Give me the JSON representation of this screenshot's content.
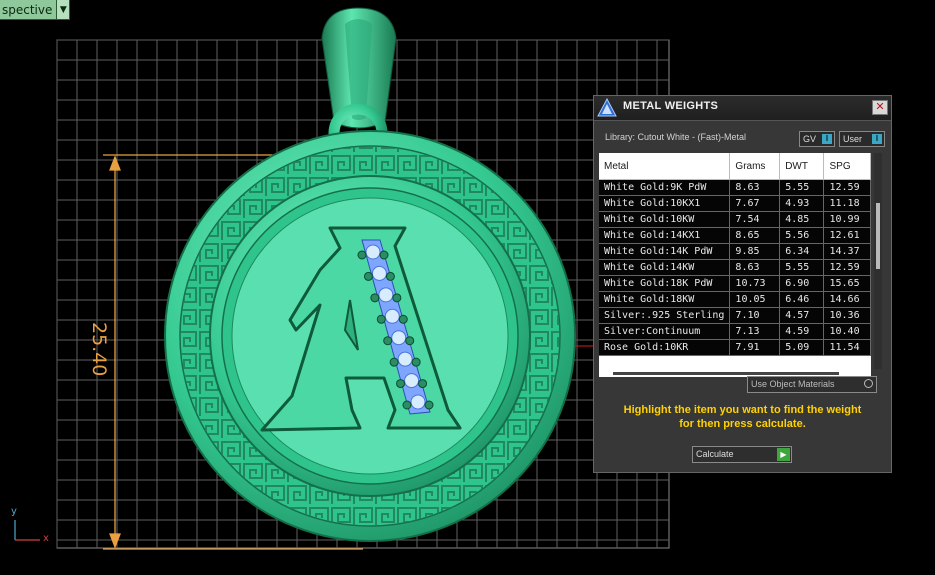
{
  "viewport": {
    "view_name": "spective",
    "dimension_label": "25.40",
    "axis_y": "y",
    "axis_x": "x"
  },
  "panel": {
    "title": "METAL WEIGHTS",
    "close_glyph": "✕",
    "library_label": "Library: Cutout White - (Fast)-Metal",
    "gv_label": "GV",
    "user_label": "User",
    "columns": [
      "Metal",
      "Grams",
      "DWT",
      "SPG"
    ],
    "rows": [
      [
        "White Gold:9K PdW",
        "8.63",
        "5.55",
        "12.59"
      ],
      [
        "White Gold:10KX1",
        "7.67",
        "4.93",
        "11.18"
      ],
      [
        "White Gold:10KW",
        "7.54",
        "4.85",
        "10.99"
      ],
      [
        "White Gold:14KX1",
        "8.65",
        "5.56",
        "12.61"
      ],
      [
        "White Gold:14K PdW",
        "9.85",
        "6.34",
        "14.37"
      ],
      [
        "White Gold:14KW",
        "8.63",
        "5.55",
        "12.59"
      ],
      [
        "White Gold:18K PdW",
        "10.73",
        "6.90",
        "15.65"
      ],
      [
        "White Gold:18KW",
        "10.05",
        "6.46",
        "14.66"
      ],
      [
        "Silver:.925 Sterling",
        "7.10",
        "4.57",
        "10.36"
      ],
      [
        "Silver:Continuum",
        "7.13",
        "4.59",
        "10.40"
      ],
      [
        "Rose Gold:10KR",
        "7.91",
        "5.09",
        "11.54"
      ]
    ],
    "use_object_materials": "Use Object Materials",
    "hint_line1": "Highlight the item you want to find the weight",
    "hint_line2": "for then press calculate.",
    "calculate_label": "Calculate"
  },
  "colors": {
    "pendant": "#3fdca0",
    "grid": "#6a6a6a",
    "dimension": "#e8a040",
    "hint": "#ffd200",
    "panel_bg": "#373737"
  },
  "icons": [
    "metal-weights-logo-icon",
    "close-icon",
    "dropdown-arrow-icon",
    "play-arrow-icon",
    "radio-icon"
  ]
}
